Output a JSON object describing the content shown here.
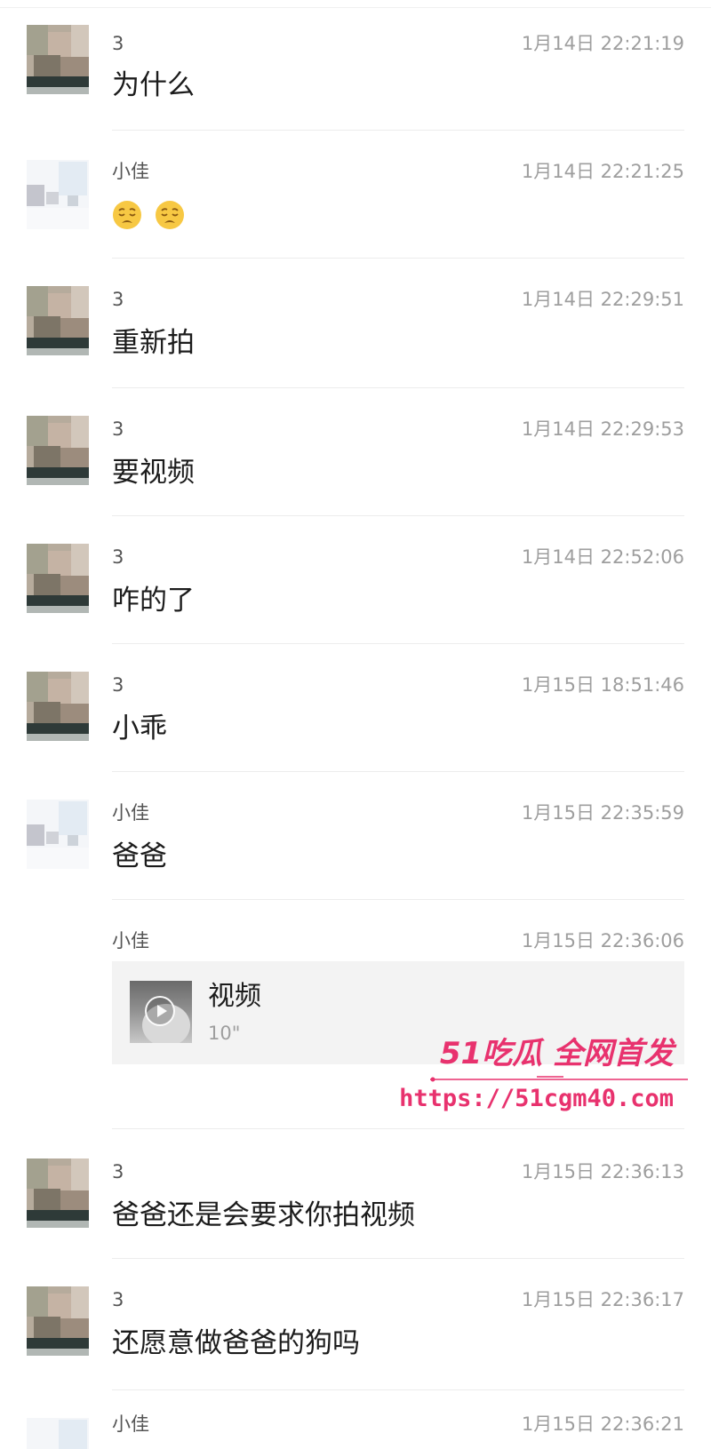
{
  "messages": [
    {
      "sender": "3",
      "time": "1月14日 22:21:19",
      "text": "为什么"
    },
    {
      "sender": "小佳",
      "time": "1月14日 22:21:25",
      "emoji": [
        "worried-face",
        "worried-face"
      ]
    },
    {
      "sender": "3",
      "time": "1月14日 22:29:51",
      "text": "重新拍"
    },
    {
      "sender": "3",
      "time": "1月14日 22:29:53",
      "text": "要视频"
    },
    {
      "sender": "3",
      "time": "1月14日 22:52:06",
      "text": "咋的了"
    },
    {
      "sender": "3",
      "time": "1月15日 18:51:46",
      "text": "小乖"
    },
    {
      "sender": "小佳",
      "time": "1月15日 22:35:59",
      "text": "爸爸"
    },
    {
      "sender": "小佳",
      "time": "1月15日 22:36:06",
      "video": {
        "title": "视频",
        "duration": "10\""
      }
    },
    {
      "sender": "3",
      "time": "1月15日 22:36:13",
      "text": "爸爸还是会要求你拍视频"
    },
    {
      "sender": "3",
      "time": "1月15日 22:36:17",
      "text": "还愿意做爸爸的狗吗"
    },
    {
      "sender": "小佳",
      "time": "1月15日 22:36:21"
    }
  ],
  "watermark": {
    "brand": "51吃瓜 全网首发",
    "url": "https://51cgm40.com",
    "color": "#e8326e"
  },
  "colors": {
    "background": "#ffffff",
    "sender": "#555555",
    "time": "#9e9e9e",
    "text": "#1c1c1c",
    "divider": "#ececec"
  }
}
